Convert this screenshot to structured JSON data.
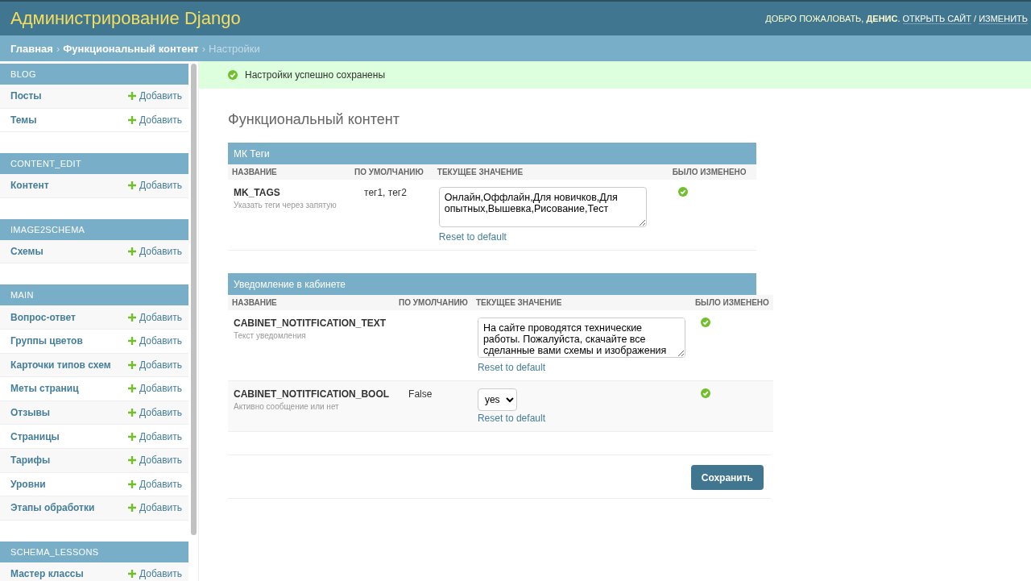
{
  "header": {
    "title": "Администрирование Django",
    "welcome": "ДОБРО ПОЖАЛОВАТЬ,",
    "user": "ДЕНИС",
    "dot": ".",
    "links": [
      "ОТКРЫТЬ САЙТ",
      "ИЗМЕНИТЬ"
    ],
    "separator": "/"
  },
  "breadcrumbs": {
    "items": [
      "Главная",
      "Функциональный контент"
    ],
    "current": "Настройки",
    "separator": "›"
  },
  "sidebar": {
    "apps": [
      {
        "name": "BLOG",
        "models": [
          {
            "name": "Посты",
            "add": "Добавить"
          },
          {
            "name": "Темы",
            "add": "Добавить"
          }
        ]
      },
      {
        "name": "CONTENT_EDIT",
        "models": [
          {
            "name": "Контент",
            "add": "Добавить"
          }
        ]
      },
      {
        "name": "IMAGE2SCHEMA",
        "models": [
          {
            "name": "Схемы",
            "add": "Добавить"
          }
        ]
      },
      {
        "name": "MAIN",
        "models": [
          {
            "name": "Вопрос-ответ",
            "add": "Добавить"
          },
          {
            "name": "Группы цветов",
            "add": "Добавить"
          },
          {
            "name": "Карточки типов схем",
            "add": "Добавить"
          },
          {
            "name": "Меты страниц",
            "add": "Добавить"
          },
          {
            "name": "Отзывы",
            "add": "Добавить"
          },
          {
            "name": "Страницы",
            "add": "Добавить"
          },
          {
            "name": "Тарифы",
            "add": "Добавить"
          },
          {
            "name": "Уровни",
            "add": "Добавить"
          },
          {
            "name": "Этапы обработки",
            "add": "Добавить"
          }
        ]
      },
      {
        "name": "SCHEMA_LESSONS",
        "models": [
          {
            "name": "Мастер классы",
            "add": "Добавить"
          }
        ]
      }
    ]
  },
  "message": {
    "text": "Настройки успешно сохранены"
  },
  "page_title": "Функциональный контент",
  "fieldsets": [
    {
      "title": "МК Теги",
      "columns": [
        "НАЗВАНИЕ",
        "ПО УМОЛЧАНИЮ",
        "ТЕКУЩЕЕ ЗНАЧЕНИЕ",
        "БЫЛО ИЗМЕНЕНО"
      ],
      "rows": [
        {
          "kind": "textarea",
          "name": "MK_TAGS",
          "help": "Указать теги через запятую",
          "default": "тег1, тег2",
          "value": "Онлайн,Оффлайн,Для новичков,Для опытных,Вышевка,Рисование,Тест",
          "reset": "Reset to default",
          "changed": true
        }
      ]
    },
    {
      "title": "Уведомление в кабинете",
      "columns": [
        "НАЗВАНИЕ",
        "ПО УМОЛЧАНИЮ",
        "ТЕКУЩЕЕ ЗНАЧЕНИЕ",
        "БЫЛО ИЗМЕНЕНО"
      ],
      "rows": [
        {
          "kind": "textarea",
          "name": "CABINET_NOTITFICATION_TEXT",
          "help": "Текст уведомления",
          "value": "На сайте проводятся технические работы. Пожалуйста, скачайте все сделанные вами схемы и изображения",
          "reset": "Reset to default",
          "changed": true
        },
        {
          "kind": "select",
          "name": "CABINET_NOTITFICATION_BOOL",
          "help": "Активно сообщение или нет",
          "default": "False",
          "value": "yes",
          "reset": "Reset to default",
          "changed": true
        }
      ]
    }
  ],
  "save_button": "Сохранить"
}
